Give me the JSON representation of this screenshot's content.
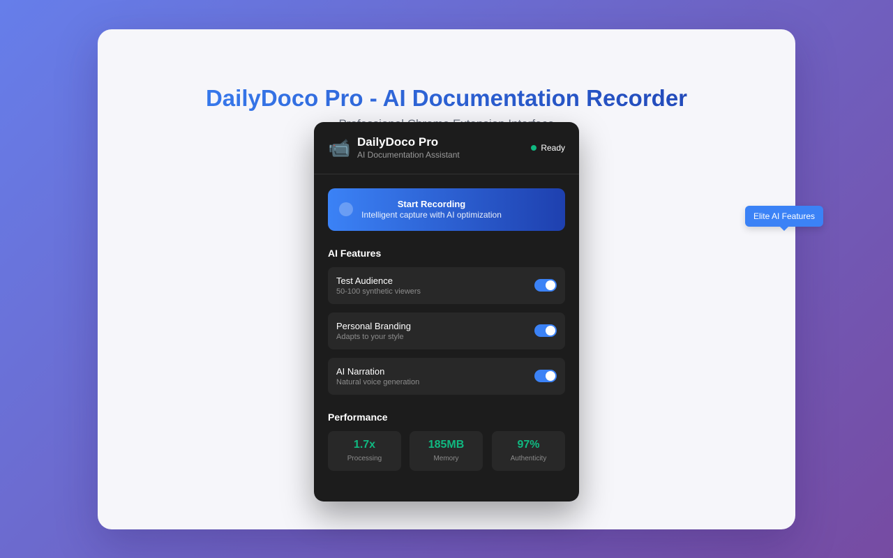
{
  "page": {
    "title": "DailyDoco Pro - AI Documentation Recorder",
    "subtitle": "Professional Chrome Extension Interface"
  },
  "popup": {
    "logo_icon": "video-camera-icon",
    "app_name": "DailyDoco Pro",
    "app_tagline": "AI Documentation Assistant",
    "status": {
      "label": "Ready",
      "color": "#10b981"
    },
    "record_button": {
      "title": "Start Recording",
      "subtitle": "Intelligent capture with AI optimization"
    },
    "features_title": "AI Features",
    "features": [
      {
        "name": "Test Audience",
        "description": "50-100 synthetic viewers",
        "enabled": true
      },
      {
        "name": "Personal Branding",
        "description": "Adapts to your style",
        "enabled": true
      },
      {
        "name": "AI Narration",
        "description": "Natural voice generation",
        "enabled": true
      }
    ],
    "performance_title": "Performance",
    "metrics": [
      {
        "value": "1.7x",
        "label": "Processing"
      },
      {
        "value": "185MB",
        "label": "Memory"
      },
      {
        "value": "97%",
        "label": "Authenticity"
      }
    ]
  },
  "tooltip": {
    "label": "Elite AI Features"
  },
  "colors": {
    "accent": "#3b82f6",
    "accent_dark": "#1e40af",
    "success": "#10b981",
    "popup_bg": "#1c1c1c"
  }
}
